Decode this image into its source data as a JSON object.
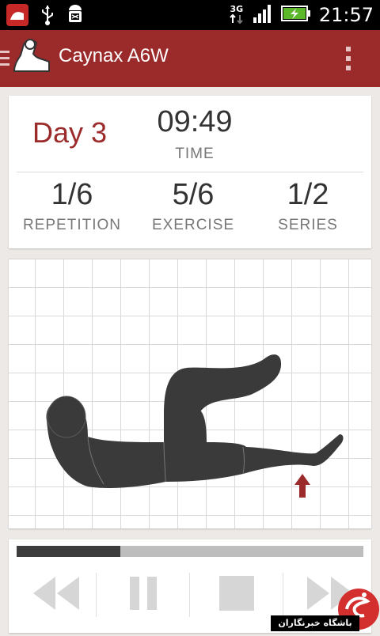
{
  "status_bar": {
    "network": "3G",
    "time": "21:57",
    "icons": [
      "app-notification-icon",
      "usb-icon",
      "android-debug-icon",
      "network-3g-icon",
      "signal-icon",
      "battery-charging-icon"
    ]
  },
  "action_bar": {
    "title": "Caynax A6W",
    "icons": [
      "navigation-drawer-icon",
      "app-logo-icon",
      "overflow-menu-icon"
    ]
  },
  "stats": {
    "day": "Day 3",
    "time_value": "09:49",
    "time_label": "TIME",
    "repetition_value": "1/6",
    "repetition_label": "REPETITION",
    "exercise_value": "5/6",
    "exercise_label": "EXERCISE",
    "series_value": "1/2",
    "series_label": "SERIES"
  },
  "exercise": {
    "illustration": "person-lying-leg-raise-figure",
    "indicator": "leg-up-arrow-icon"
  },
  "progress": {
    "fraction": 0.3
  },
  "controls": {
    "icons": [
      "rewind-icon",
      "pause-icon",
      "stop-icon",
      "fast-forward-icon"
    ]
  },
  "watermark": {
    "text": "باشگاه خبرنگاران"
  },
  "colors": {
    "accent": "#9b2b2b",
    "status_bar": "#000000",
    "background": "#ece9e6",
    "figure": "#3a3a3a",
    "progress_fill": "#3d3d3d",
    "progress_track": "#bdbdbd"
  }
}
